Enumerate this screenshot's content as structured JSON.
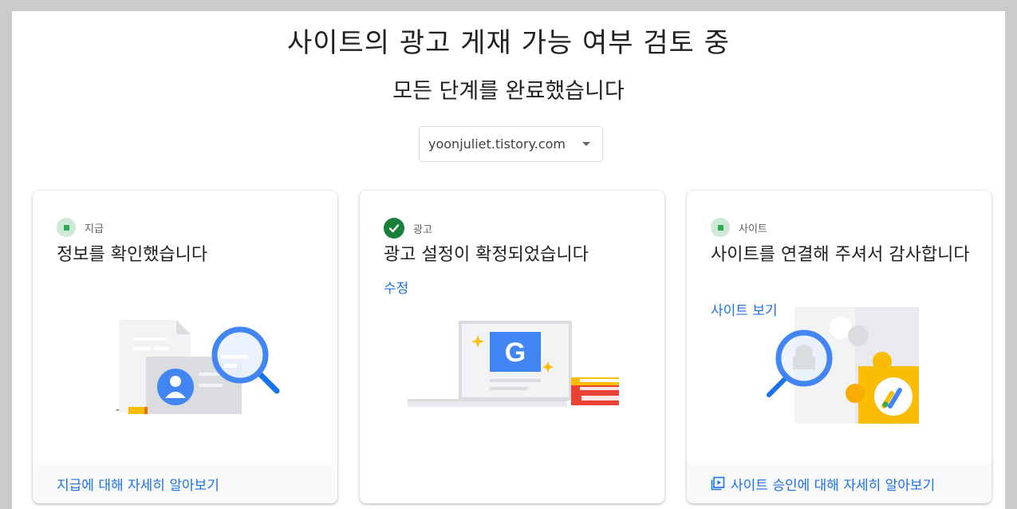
{
  "header": {
    "title": "사이트의 광고 게재 가능 여부 검토 중",
    "subtitle": "모든 단계를 완료했습니다"
  },
  "site_selector": {
    "selected": "yoonjuliet.tistory.com"
  },
  "cards": [
    {
      "step_label": "지급",
      "status": "pending",
      "title": "정보를 확인했습니다",
      "footer_link": "지급에 대해 자세히 알아보기"
    },
    {
      "step_label": "광고",
      "status": "done",
      "title": "광고 설정이 확정되었습니다",
      "link": "수정",
      "illustration_letter": "G"
    },
    {
      "step_label": "사이트",
      "status": "pending",
      "title": "사이트를 연결해 주셔서 감사합니다",
      "link": "사이트 보기",
      "footer_link": "사이트 승인에 대해 자세히 알아보기"
    }
  ],
  "colors": {
    "accent_blue": "#1a73e8",
    "success_green": "#188038",
    "pending_green_bg": "#ceead6",
    "pending_green": "#34a853",
    "footer_bg": "#f8f9fa"
  }
}
